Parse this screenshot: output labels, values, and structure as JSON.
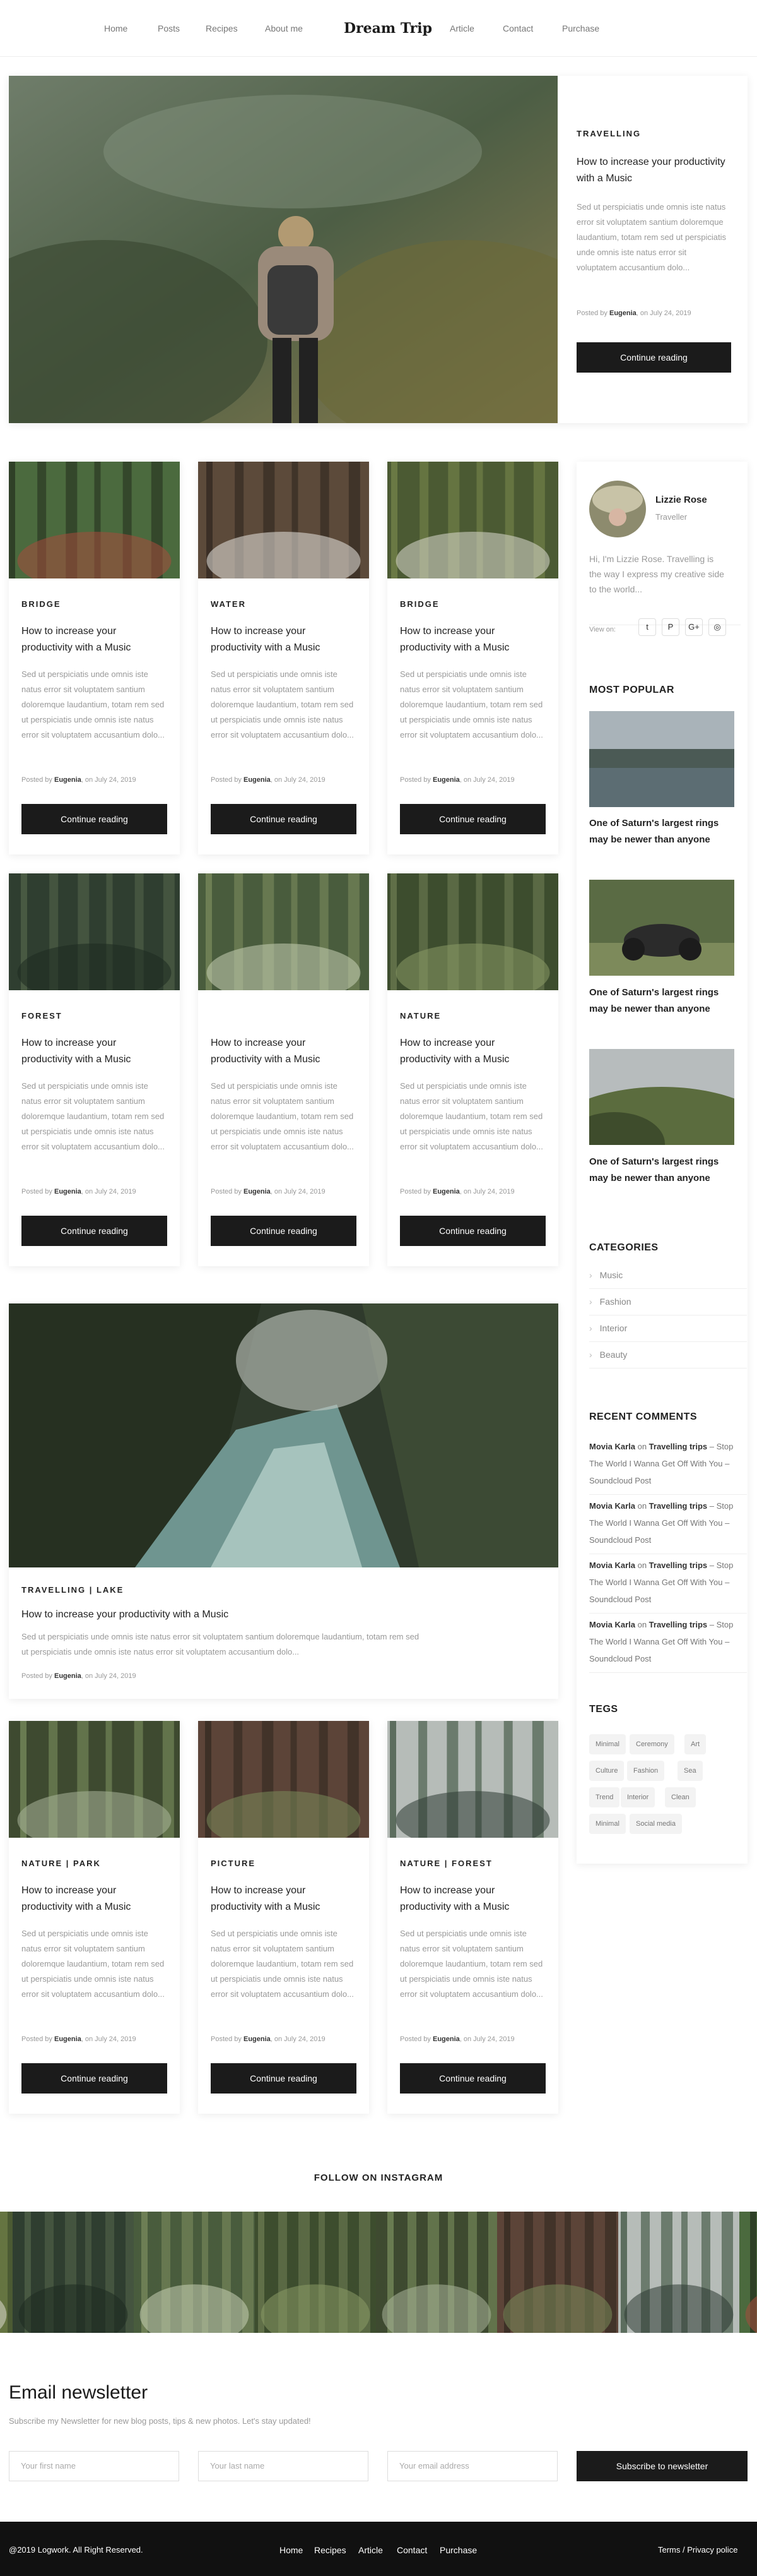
{
  "header": {
    "logo": "Dream Trip",
    "nav_left": [
      "Home",
      "Posts",
      "Recipes",
      "About me"
    ],
    "nav_right": [
      "Article",
      "Contact",
      "Purchase"
    ]
  },
  "featured": {
    "category": "TRAVELLING",
    "title": "How to increase your productivity with a Music",
    "excerpt": "Sed ut perspiciatis unde omnis iste natus error sit voluptatem santium doloremque laudantium, totam rem sed ut perspiciatis unde omnis iste natus error sit voluptatem accusantium dolo...",
    "meta_prefix": "Posted by",
    "author": "Eugenia",
    "meta_suffix": ", on July 24, 2019",
    "button": "Continue reading"
  },
  "posts": [
    {
      "category": "BRIDGE",
      "title": "How to increase your productivity with a Music",
      "excerpt": "Sed ut perspiciatis unde omnis iste natus error sit voluptatem santium doloremque laudantium, totam rem sed ut perspiciatis unde omnis iste natus error sit voluptatem accusantium dolo...",
      "author": "Eugenia",
      "date": ", on July 24, 2019",
      "button": "Continue reading"
    },
    {
      "category": "WATER",
      "title": "How to increase your productivity with a Music",
      "excerpt": "Sed ut perspiciatis unde omnis iste natus error sit voluptatem santium doloremque laudantium, totam rem sed ut perspiciatis unde omnis iste natus error sit voluptatem accusantium dolo...",
      "author": "Eugenia",
      "date": ", on July 24, 2019",
      "button": "Continue reading"
    },
    {
      "category": "BRIDGE",
      "title": "How to increase your productivity with a Music",
      "excerpt": "Sed ut perspiciatis unde omnis iste natus error sit voluptatem santium doloremque laudantium, totam rem sed ut perspiciatis unde omnis iste natus error sit voluptatem accusantium dolo...",
      "author": "Eugenia",
      "date": ", on July 24, 2019",
      "button": "Continue reading"
    },
    {
      "category": "FOREST",
      "title": "How to increase your productivity with a Music",
      "excerpt": "Sed ut perspiciatis unde omnis iste natus error sit voluptatem santium doloremque laudantium, totam rem sed ut perspiciatis unde omnis iste natus error sit voluptatem accusantium dolo...",
      "author": "Eugenia",
      "date": ", on July 24, 2019",
      "button": "Continue reading"
    },
    {
      "category": "",
      "title": "How to increase your productivity with a Music",
      "excerpt": "Sed ut perspiciatis unde omnis iste natus error sit voluptatem santium doloremque laudantium, totam rem sed ut perspiciatis unde omnis iste natus error sit voluptatem accusantium dolo...",
      "author": "Eugenia",
      "date": ", on July 24, 2019",
      "button": "Continue reading"
    },
    {
      "category": "NATURE",
      "title": "How to increase your productivity with a Music",
      "excerpt": "Sed ut perspiciatis unde omnis iste natus error sit voluptatem santium doloremque laudantium, totam rem sed ut perspiciatis unde omnis iste natus error sit voluptatem accusantium dolo...",
      "author": "Eugenia",
      "date": ", on July 24, 2019",
      "button": "Continue reading"
    }
  ],
  "wide_post": {
    "category": "TRAVELLING | LAKE",
    "title": "How to increase your productivity with a Music",
    "excerpt": "Sed ut perspiciatis unde omnis iste natus error sit voluptatem santium doloremque laudantium, totam rem sed ut perspiciatis unde omnis iste natus error sit voluptatem accusantium dolo...",
    "author": "Eugenia",
    "date": ", on July 24, 2019"
  },
  "posts2": [
    {
      "category": "NATURE | PARK",
      "title": "How to increase your productivity with a Music",
      "excerpt": "Sed ut perspiciatis unde omnis iste natus error sit voluptatem santium doloremque laudantium, totam rem sed ut perspiciatis unde omnis iste natus error sit voluptatem accusantium dolo...",
      "author": "Eugenia",
      "date": ", on July 24, 2019",
      "button": "Continue reading"
    },
    {
      "category": "PICTURE",
      "title": "How to increase your productivity with a Music",
      "excerpt": "Sed ut perspiciatis unde omnis iste natus error sit voluptatem santium doloremque laudantium, totam rem sed ut perspiciatis unde omnis iste natus error sit voluptatem accusantium dolo...",
      "author": "Eugenia",
      "date": ", on July 24, 2019",
      "button": "Continue reading"
    },
    {
      "category": "NATURE | FOREST",
      "title": "How to increase your productivity with a Music",
      "excerpt": "Sed ut perspiciatis unde omnis iste natus error sit voluptatem santium doloremque laudantium, totam rem sed ut perspiciatis unde omnis iste natus error sit voluptatem accusantium dolo...",
      "author": "Eugenia",
      "date": ", on July 24, 2019",
      "button": "Continue reading"
    }
  ],
  "sidebar": {
    "profile_name": "Lizzie Rose",
    "profile_role": "Traveller",
    "bio": "Hi, I'm Lizzie Rose. Travelling is the way I express my creative side to the world...",
    "view_on": "View on:",
    "social": [
      "twitter-icon",
      "pinterest-icon",
      "google-plus-icon",
      "instagram-icon"
    ],
    "most_popular_heading": "MOST POPULAR",
    "popular": [
      "One of Saturn's largest rings may be newer than anyone",
      "One of Saturn's largest rings may be newer than anyone",
      "One of Saturn's largest rings may be newer than anyone"
    ],
    "categories_heading": "CATEGORIES",
    "categories": [
      "Music",
      "Fashion",
      "Interior",
      "Beauty"
    ],
    "recent_heading": "RECENT COMMENTS",
    "comments": [
      {
        "author": "Movia Karla",
        "on": " on ",
        "post": "Travelling trips",
        "rest": " – Stop The World I Wanna Get Off With You – Soundcloud Post"
      },
      {
        "author": "Movia Karla",
        "on": " on ",
        "post": "Travelling trips",
        "rest": " – Stop The World I Wanna Get Off With You – Soundcloud Post"
      },
      {
        "author": "Movia Karla",
        "on": " on ",
        "post": "Travelling trips",
        "rest": " – Stop The World I Wanna Get Off With You – Soundcloud Post"
      },
      {
        "author": "Movia Karla",
        "on": " on ",
        "post": "Travelling trips",
        "rest": " – Stop The World I Wanna Get Off With You – Soundcloud Post"
      }
    ],
    "tags_heading": "TEGS",
    "tags": [
      "Minimal",
      "Ceremony",
      "Art",
      "Culture",
      "Fashion",
      "Sea",
      "Trend",
      "Interior",
      "Clean",
      "Minimal",
      "Social media"
    ]
  },
  "instagram": {
    "heading": "FOLLOW ON INSTAGRAM"
  },
  "newsletter": {
    "heading": "Email newsletter",
    "subtext": "Subscribe my Newsletter for new blog posts, tips & new photos. Let's stay updated!",
    "first_placeholder": "Your first name",
    "last_placeholder": "Your last name",
    "email_placeholder": "Your email address",
    "button": "Subscribe to newsletter"
  },
  "footer": {
    "copyright": "@2019 Logwork. All Right Reserved.",
    "links": [
      "Home",
      "Recipes",
      "Article",
      "Contact",
      "Purchase"
    ],
    "legal": "Terms / Privacy police"
  },
  "colors": {
    "dark": "#1b1b1b",
    "muted": "#999999",
    "footer_bg": "#111111"
  }
}
